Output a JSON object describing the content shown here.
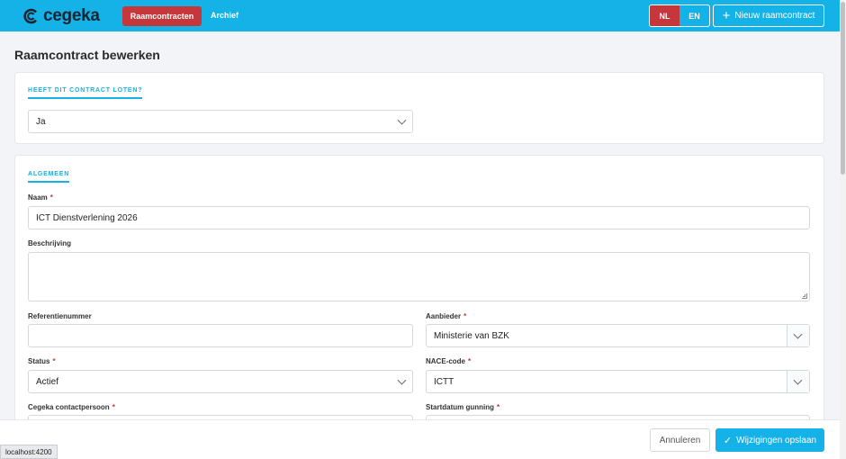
{
  "header": {
    "logo_text": "cegeka",
    "nav": {
      "active": "Raamcontracten",
      "link": "Archief"
    },
    "languages": [
      "NL",
      "EN"
    ],
    "active_language": "NL",
    "new_button": "Nieuw raamcontract",
    "accent_color": "#14b2e6",
    "brand_red": "#c5373a"
  },
  "page": {
    "title": "Raamcontract bewerken"
  },
  "lots_section": {
    "tab": "HEEFT DIT CONTRACT LOTEN?",
    "select_value": "Ja"
  },
  "general": {
    "tab": "ALGEMEEN",
    "naam": {
      "label": "Naam",
      "required": "*",
      "value": "ICT Dienstverlening 2026"
    },
    "beschrijving": {
      "label": "Beschrijving",
      "value": ""
    },
    "referentienummer": {
      "label": "Referentienummer",
      "value": ""
    },
    "aanbieder": {
      "label": "Aanbieder",
      "required": "*",
      "value": "Ministerie van BZK"
    },
    "status": {
      "label": "Status",
      "required": "*",
      "value": "Actief"
    },
    "nace": {
      "label": "NACE-code",
      "required": "*",
      "value": "ICTT"
    },
    "contactpersoon": {
      "label": "Cegeka contactpersoon",
      "required": "*"
    },
    "startdatum": {
      "label": "Startdatum gunning",
      "required": "*"
    }
  },
  "footer": {
    "cancel": "Annuleren",
    "save": "Wijzigingen opslaan"
  },
  "statusbar": {
    "url": "localhost:4200"
  }
}
